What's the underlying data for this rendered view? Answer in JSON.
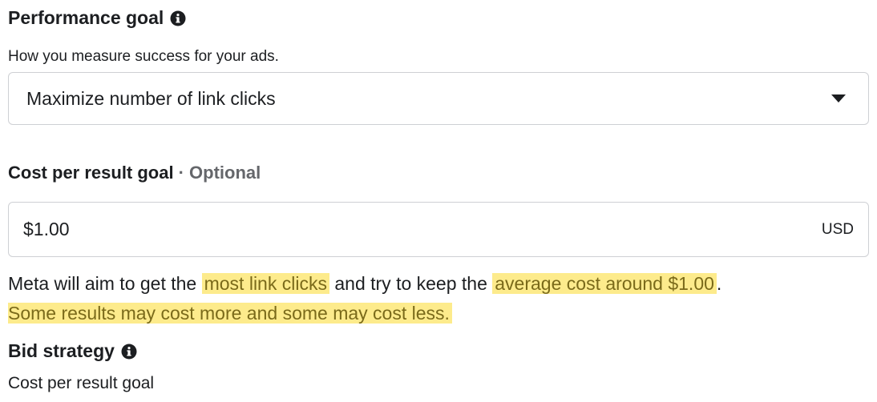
{
  "performance_goal": {
    "heading": "Performance goal",
    "info_icon": "info-icon",
    "subtext": "How you measure success for your ads.",
    "selected": "Maximize number of link clicks",
    "dropdown_icon": "caret-down-icon"
  },
  "cost_goal": {
    "heading": "Cost per result goal",
    "optional": "· Optional",
    "value": "$1.00",
    "currency": "USD"
  },
  "description": {
    "part1": "Meta will aim to get the ",
    "highlight1": "most link clicks",
    "part2": " and try to keep the ",
    "highlight2": "average cost around $1.00",
    "part3": ".",
    "highlight3": "Some results may cost more and some may cost less."
  },
  "bid_strategy": {
    "heading": "Bid strategy",
    "info_icon": "info-icon",
    "value": "Cost per result goal"
  },
  "colors": {
    "text": "#1c1e21",
    "muted": "#65676b",
    "border": "#ced0d4",
    "highlight_bg": "#fdeb8c",
    "highlight_text": "#7a6a1a"
  }
}
